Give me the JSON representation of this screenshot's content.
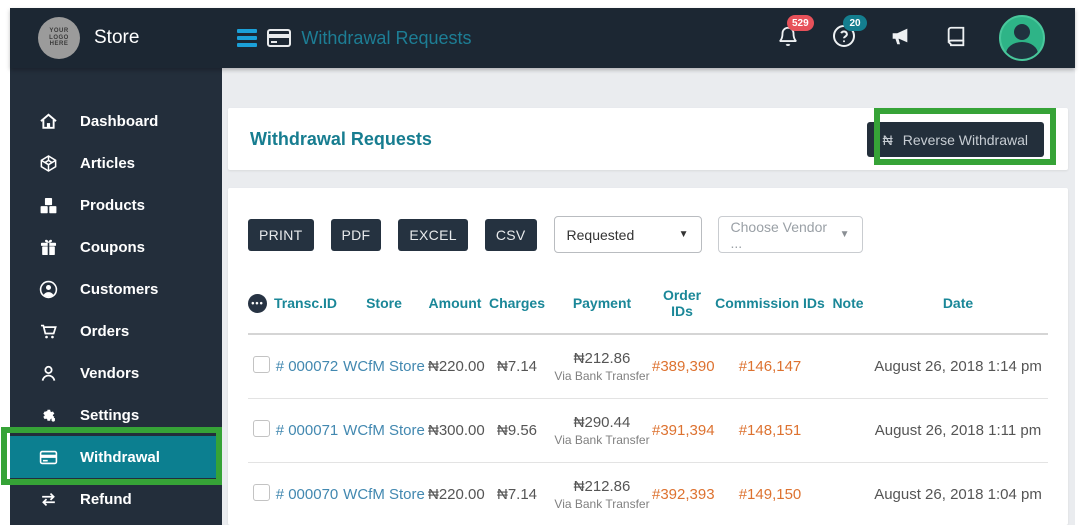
{
  "header": {
    "logo_text": "YOUR LOGO HERE",
    "brand": "Store",
    "page_title": "Withdrawal Requests",
    "notification_count": "529",
    "help_count": "20"
  },
  "sidebar": {
    "items": [
      {
        "label": "Dashboard"
      },
      {
        "label": "Articles"
      },
      {
        "label": "Products"
      },
      {
        "label": "Coupons"
      },
      {
        "label": "Customers"
      },
      {
        "label": "Orders"
      },
      {
        "label": "Vendors"
      },
      {
        "label": "Settings"
      },
      {
        "label": "Withdrawal",
        "active": true
      },
      {
        "label": "Refund"
      }
    ]
  },
  "panel": {
    "title": "Withdrawal Requests",
    "reverse_button": {
      "currency_icon": "₦",
      "label": "Reverse Withdrawal"
    }
  },
  "toolbar": {
    "export_buttons": [
      "PRINT",
      "PDF",
      "EXCEL",
      "CSV"
    ],
    "status_select_value": "Requested",
    "vendor_select_placeholder": "Choose Vendor ..."
  },
  "table": {
    "columns": [
      "Transc.ID",
      "Store",
      "Amount",
      "Charges",
      "Payment",
      "Order IDs",
      "Commission IDs",
      "Note",
      "Date"
    ],
    "rows": [
      {
        "transc_id": "# 000072",
        "store": "WCfM Store",
        "amount": "₦220.00",
        "charges": "₦7.14",
        "payment_amount": "₦212.86",
        "payment_method": "Via Bank Transfer",
        "order_ids": "#389,390",
        "commission_ids": "#146,147",
        "note": "",
        "date": "August 26, 2018 1:14 pm"
      },
      {
        "transc_id": "# 000071",
        "store": "WCfM Store",
        "amount": "₦300.00",
        "charges": "₦9.56",
        "payment_amount": "₦290.44",
        "payment_method": "Via Bank Transfer",
        "order_ids": "#391,394",
        "commission_ids": "#148,151",
        "note": "",
        "date": "August 26, 2018 1:11 pm"
      },
      {
        "transc_id": "# 000070",
        "store": "WCfM Store",
        "amount": "₦220.00",
        "charges": "₦7.14",
        "payment_amount": "₦212.86",
        "payment_method": "Via Bank Transfer",
        "order_ids": "#392,393",
        "commission_ids": "#149,150",
        "note": "",
        "date": "August 26, 2018 1:04 pm"
      }
    ]
  },
  "colors": {
    "dark_navy": "#1c2733",
    "sidebar_dark": "#232e3b",
    "active_teal": "#0c7f90",
    "heading_teal": "#177d90",
    "column_teal": "#1a8798",
    "link_blue": "#4288b0",
    "link_orange": "#dd7230",
    "annotation_green": "#36a337",
    "badge_red": "#e7515a",
    "badge_teal": "#147e8f",
    "avatar_green": "#2eb487"
  }
}
